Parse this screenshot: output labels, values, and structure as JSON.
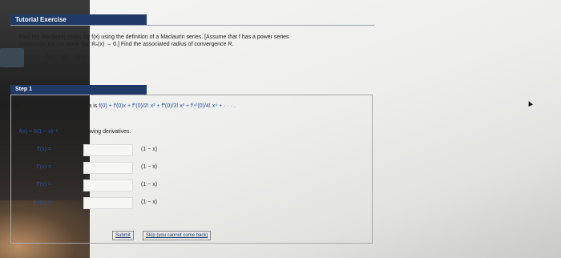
{
  "header": {
    "title": "Tutorial Exercise"
  },
  "problem": {
    "line1": "Find the Maclaurin series for f(x) using the definition of a Maclaurin series. [Assume that f has a power series",
    "line2": "expansion. Do not show that Rₙ(x) → 0.] Find the associated radius of convergence R.",
    "function": "f(x) = 6(1 − x)⁻²"
  },
  "step": {
    "title": "Step 1",
    "formula_prefix": "The Maclaurin series formula is",
    "formula_terms": "f(0) + f′(0)x + f″(0)/2! x² + f‴(0)/3! x³ + f⁽⁴⁾(0)/4! x⁴ + · · · .",
    "derivatives_intro_fx": "f(x) = 6(1 − x)⁻²",
    "derivatives_intro_text": "has the following derivatives.",
    "rows": [
      {
        "label": "f′(x) =",
        "denominator": "(1 − x)"
      },
      {
        "label": "f″(x) =",
        "denominator": "(1 − x)"
      },
      {
        "label": "f‴(x) =",
        "denominator": "(1 − x)"
      },
      {
        "label": "f⁽⁴⁾(x) =",
        "denominator": "(1 − x)"
      }
    ]
  },
  "buttons": {
    "submit": "Submit",
    "skip": "Skip (you cannot come back)"
  }
}
